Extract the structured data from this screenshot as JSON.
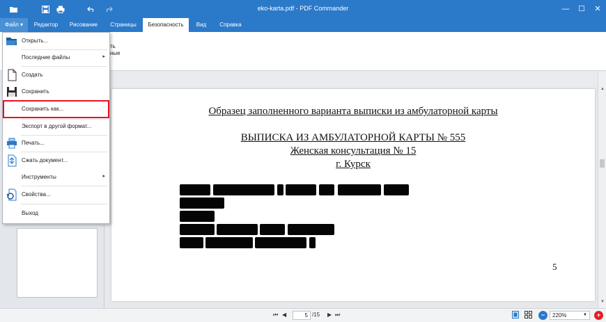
{
  "window": {
    "title": "eko-karta.pdf - PDF Commander"
  },
  "quick_access": {
    "open_icon": "folder-open-icon",
    "save_icon": "save-icon",
    "print_icon": "print-icon",
    "undo_icon": "undo-icon",
    "redo_icon": "redo-icon"
  },
  "window_controls": {
    "minimize": "—",
    "maximize": "☐",
    "close": "✕"
  },
  "tabs": [
    {
      "label": "Файл ▾"
    },
    {
      "label": "Редактор"
    },
    {
      "label": "Рисование"
    },
    {
      "label": "Страницы"
    },
    {
      "label": "Безопасность"
    },
    {
      "label": "Вид"
    },
    {
      "label": "Справка"
    }
  ],
  "ribbon_fragment": {
    "line1": "ть",
    "line2": "ные"
  },
  "file_menu": {
    "items": [
      {
        "label": "Открыть...",
        "icon": "folder-open-icon"
      },
      {
        "label": "Последние файлы",
        "icon": "",
        "submenu": "▸"
      },
      {
        "label": "Создать",
        "icon": "new-document-icon"
      },
      {
        "label": "Сохранить",
        "icon": "floppy-disk-icon"
      },
      {
        "label": "Сохранить как...",
        "icon": ""
      },
      {
        "label": "Экспорт в другой формат...",
        "icon": ""
      },
      {
        "label": "Печать...",
        "icon": "printer-icon"
      },
      {
        "label": "Сжать документ...",
        "icon": "compress-icon"
      },
      {
        "label": "Инструменты",
        "icon": "",
        "submenu": "▸"
      },
      {
        "label": "Свойства...",
        "icon": "properties-icon"
      },
      {
        "label": "Выход",
        "icon": ""
      }
    ],
    "highlighted_item": "Сохранить как...",
    "highlight_color": "#e8111e"
  },
  "document": {
    "heading": "Образец заполненного варианта выписки из амбулаторной карты",
    "title": "ВЫПИСКА ИЗ АМБУЛАТОРНОЙ КАРТЫ № 555",
    "subtitle": "Женская консультация № 15",
    "city": "г. Курск",
    "page_number": "5"
  },
  "status_bar": {
    "first": "⏮",
    "prev": "◀",
    "current_page": "5",
    "total_pages": "/15",
    "next": "▶",
    "last": "⏭",
    "zoom": "220%",
    "zoom_out": "−",
    "zoom_in": "+"
  },
  "colors": {
    "accent": "#2b79c9",
    "zoom_out": "#2b79c9",
    "zoom_in": "#e0202a"
  }
}
